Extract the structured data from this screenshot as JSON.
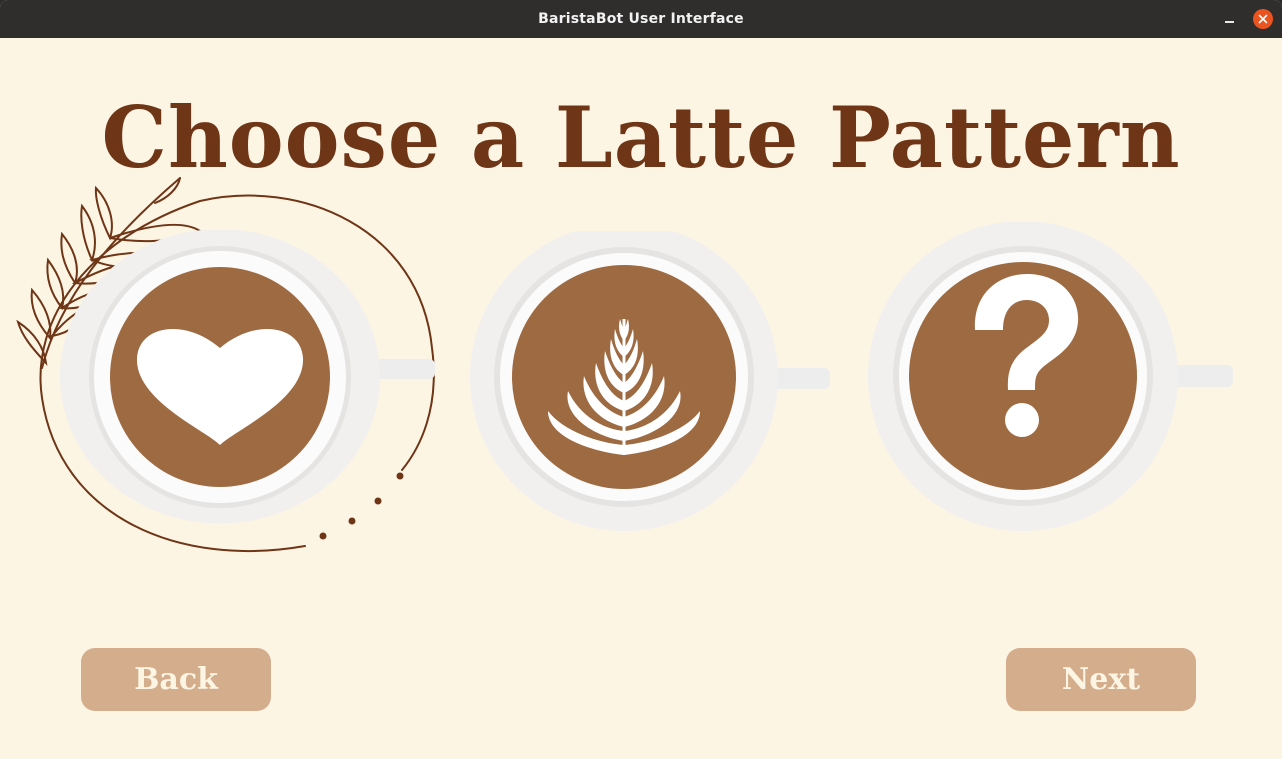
{
  "window": {
    "title": "BaristaBot User Interface"
  },
  "heading": "Choose a Latte Pattern",
  "patterns": [
    {
      "icon": "heart-icon"
    },
    {
      "icon": "rosetta-leaf-icon"
    },
    {
      "icon": "question-mark-icon"
    }
  ],
  "buttons": {
    "back": "Back",
    "next": "Next"
  },
  "colors": {
    "background": "#fdf5e4",
    "heading": "#6e3516",
    "button": "#d3ad8c",
    "coffee": "#9e6a42",
    "ornament": "#6e3516"
  }
}
